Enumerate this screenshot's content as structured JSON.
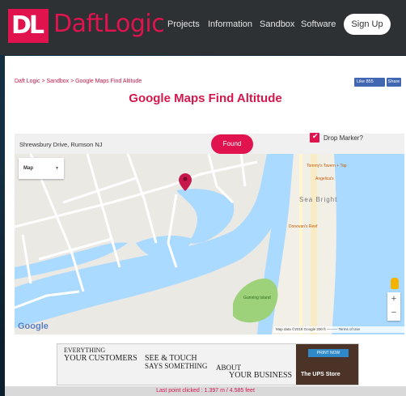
{
  "header": {
    "logo_mark": "DL",
    "brand_daft": "Daft",
    "brand_logic": "Logic",
    "nav": [
      "Projects",
      "Information",
      "Sandbox",
      "Software"
    ],
    "signup": "Sign Up"
  },
  "breadcrumb": "Daft Logic > Sandbox > Google Maps Find Altitude",
  "social": {
    "like": "Like 855",
    "share": "Share"
  },
  "page_title": "Google Maps Find Altitude",
  "search": {
    "value": "Shrewsbury Drive, Rumson NJ",
    "button": "Found"
  },
  "drop_marker": {
    "label": "Drop Marker?",
    "checked": true
  },
  "map": {
    "type_label": "Map",
    "labels": [
      "Tommy's Tavern + Tap",
      "Angelica's",
      "Sea Bright",
      "Donovan's Reef",
      "Gunning Island"
    ],
    "attribution": "Map data ©2018 Google   200 ft ———   Terms of Use",
    "google_logo": "Google",
    "zoom_in": "+",
    "zoom_out": "−"
  },
  "ad": {
    "lines": [
      "EVERYTHING",
      "YOUR CUSTOMERS",
      "SEE & TOUCH",
      "SAYS SOMETHING",
      "ABOUT",
      "YOUR BUSINESS"
    ],
    "badge": "PRINT NOW",
    "store": "The UPS Store"
  },
  "last_point": "Last point clicked : 1.397 m / 4.585 feet",
  "colors": {
    "accent": "#e0134e",
    "header_bg": "#2d3134",
    "water": "#aadaff",
    "park": "#9dd17a"
  }
}
